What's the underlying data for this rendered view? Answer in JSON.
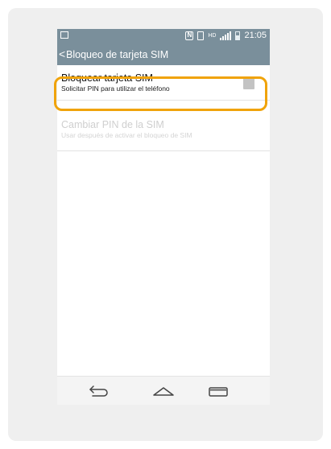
{
  "status_bar": {
    "time": "21:05",
    "icons": [
      "picture-icon",
      "nfc-icon",
      "sim-icon",
      "hd-icon",
      "signal-icon",
      "battery-icon"
    ],
    "hd_label": "HD"
  },
  "action_bar": {
    "back_glyph": "<",
    "title": "Bloqueo de tarjeta SIM"
  },
  "preferences": [
    {
      "title": "Bloquear tarjeta SIM",
      "summary": "Solicitar PIN para utilizar el teléfono",
      "enabled": true,
      "checked": false
    },
    {
      "title": "Cambiar PIN de la SIM",
      "summary": "Usar después de activar el bloqueo de SIM",
      "enabled": false
    }
  ],
  "nav_bar": {
    "buttons": [
      "back-icon",
      "home-icon",
      "recent-apps-icon"
    ]
  },
  "colors": {
    "header": "#7a8f9b",
    "highlight": "#f0a30a",
    "checkbox": "#c3c3c3"
  }
}
